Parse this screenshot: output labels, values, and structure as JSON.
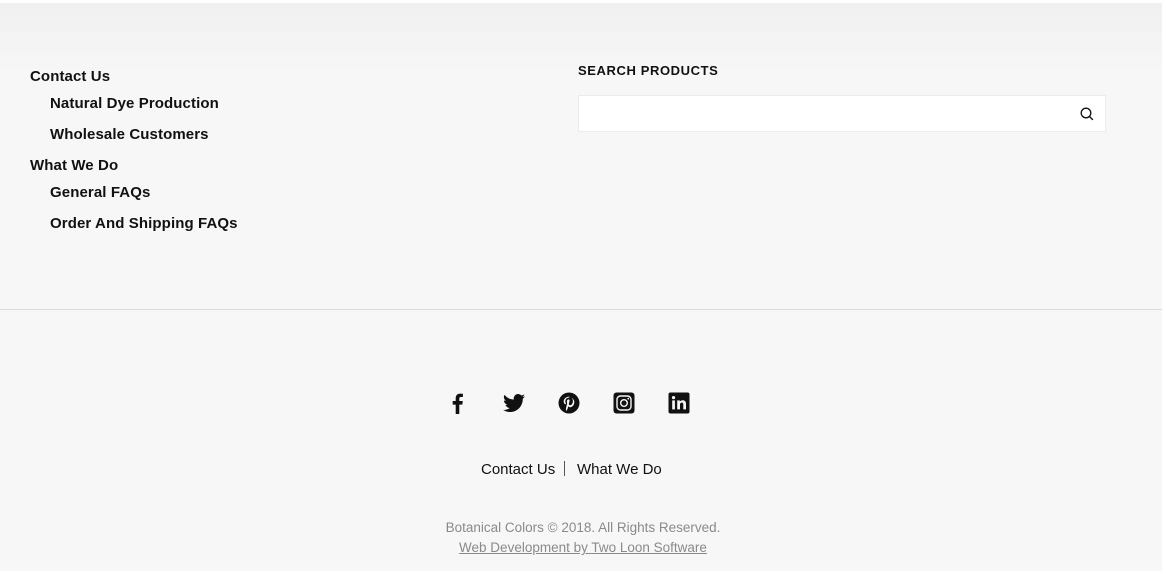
{
  "nav": {
    "items": [
      {
        "label": "Contact Us",
        "level": 0
      },
      {
        "label": "Natural Dye Production",
        "level": 1
      },
      {
        "label": "Wholesale Customers",
        "level": 1
      },
      {
        "label": "What We Do",
        "level": 0
      },
      {
        "label": "General FAQs",
        "level": 1
      },
      {
        "label": "Order And Shipping FAQs",
        "level": 1
      }
    ]
  },
  "search": {
    "heading": "SEARCH PRODUCTS",
    "value": "",
    "placeholder": ""
  },
  "social": {
    "icons": [
      "facebook-icon",
      "twitter-icon",
      "pinterest-icon",
      "instagram-icon",
      "linkedin-icon"
    ]
  },
  "footer": {
    "links": [
      "Contact Us",
      "What We Do"
    ],
    "copyright": "Botanical Colors © 2018. All Rights Reserved.",
    "credit": "Web Development by Two Loon Software"
  }
}
